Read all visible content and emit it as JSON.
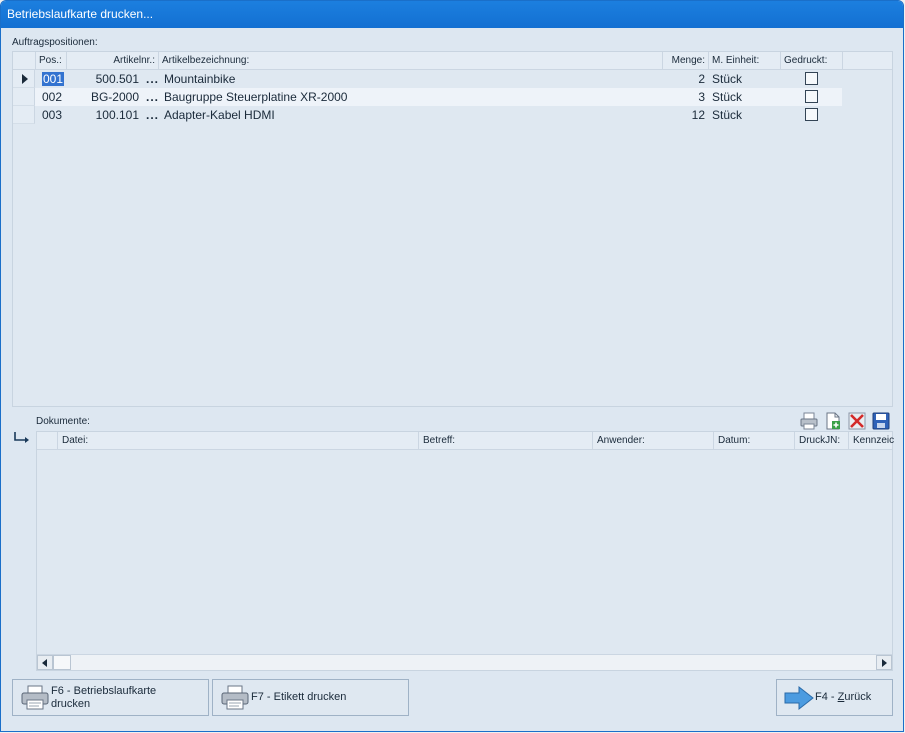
{
  "window": {
    "title": "Betriebslaufkarte drucken..."
  },
  "positions": {
    "label": "Auftragspositionen:",
    "columns": {
      "pos": "Pos.:",
      "artikelnr": "Artikelnr.:",
      "bezeichnung": "Artikelbezeichnung:",
      "menge": "Menge:",
      "einheit": "M. Einheit:",
      "gedruckt": "Gedruckt:"
    },
    "rows": [
      {
        "pos": "001",
        "artikelnr": "500.501",
        "more": "...",
        "bezeichnung": "Mountainbike",
        "menge": "2",
        "einheit": "Stück",
        "gedruckt": false
      },
      {
        "pos": "002",
        "artikelnr": "BG-2000",
        "more": "...",
        "bezeichnung": "Baugruppe Steuerplatine XR-2000",
        "menge": "3",
        "einheit": "Stück",
        "gedruckt": false
      },
      {
        "pos": "003",
        "artikelnr": "100.101",
        "more": "...",
        "bezeichnung": "Adapter-Kabel HDMI",
        "menge": "12",
        "einheit": "Stück",
        "gedruckt": false
      }
    ]
  },
  "documents": {
    "label": "Dokumente:",
    "columns": {
      "datei": "Datei:",
      "betreff": "Betreff:",
      "anwender": "Anwender:",
      "datum": "Datum:",
      "druckjn": "DruckJN:",
      "kennzeichen": "Kennzeic"
    },
    "toolbar_icons": [
      "print-icon",
      "add-document-icon",
      "delete-icon",
      "save-icon"
    ]
  },
  "buttons": {
    "f6_line1": "F6 - Betriebslaufkarte",
    "f6_line2": "drucken",
    "f7": "F7 - Etikett drucken",
    "f4_prefix": "F4 - ",
    "f4_underlined": "Z",
    "f4_rest": "urück"
  },
  "colors": {
    "titlebar": "#1370d2",
    "selection": "#3373d0",
    "background": "#dde7f1"
  }
}
